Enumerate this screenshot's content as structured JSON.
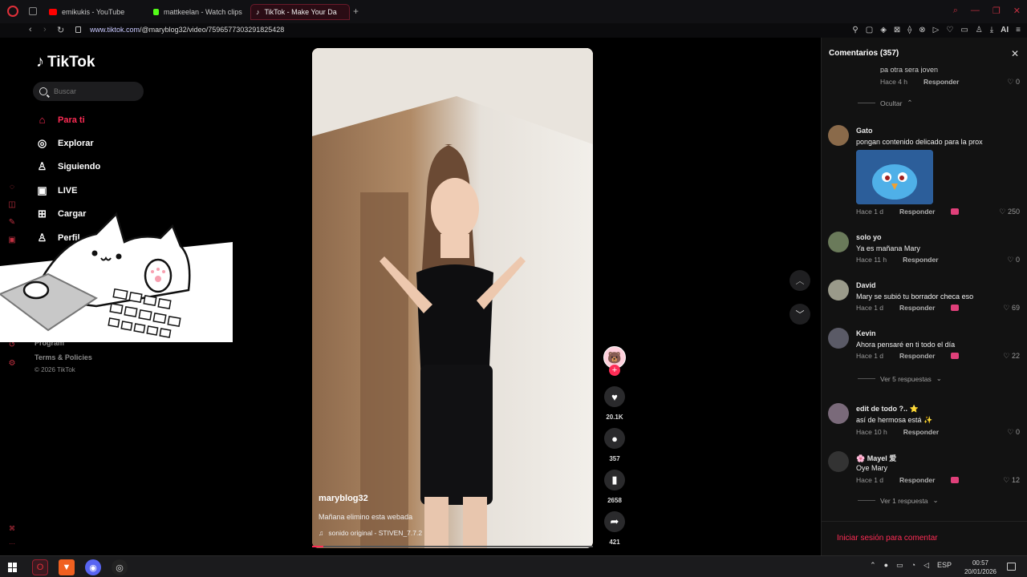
{
  "browser": {
    "tabs": [
      {
        "label": "emikukis - YouTube",
        "favicon_color": "#ff0000"
      },
      {
        "label": "mattkeelan - Watch clips",
        "favicon_color": "#53fc18"
      },
      {
        "label": "TikTok - Make Your Da",
        "favicon_color": "#ffffff"
      }
    ],
    "new_tab": "+",
    "url_domain": "www.tiktok.com",
    "url_path": "/@maryblog32/video/7596577303291825428",
    "ai_label": "AI",
    "window_controls": [
      "⌕",
      "—",
      "❐",
      "✕"
    ]
  },
  "tiktok": {
    "logo": "TikTok",
    "search_placeholder": "Buscar",
    "nav": [
      {
        "label": "Para ti",
        "icon": "home-icon",
        "active": true
      },
      {
        "label": "Explorar",
        "icon": "compass-icon"
      },
      {
        "label": "Siguiendo",
        "icon": "person-icon"
      },
      {
        "label": "LIVE",
        "icon": "live-icon"
      },
      {
        "label": "Cargar",
        "icon": "upload-icon"
      },
      {
        "label": "Perfil",
        "icon": "profile-icon"
      }
    ],
    "more": "...",
    "footer_links": [
      "Program",
      "Terms & Policies"
    ],
    "copyright": "© 2026 TikTok"
  },
  "video": {
    "username": "maryblog32",
    "description": "Mañana elimino esta webada",
    "sound": "sonido original - STIVEN_7.7.2",
    "progress": 0.04,
    "likes": "20.1K",
    "comments": "357",
    "saves": "2658",
    "shares": "421"
  },
  "comments_panel": {
    "title": "Comentarios (357)",
    "top_partial": {
      "text": "pa otra sera joven",
      "time": "Hace 4 h",
      "reply": "Responder",
      "likes": "0"
    },
    "hide_label": "Ocultar",
    "items": [
      {
        "name": "Gato",
        "text": "pongan contenido delicado para la prox",
        "time": "Hace 1 d",
        "reply": "Responder",
        "likes": "250",
        "creator_liked": true,
        "avatar_color": "#8a6a4a",
        "has_image": true
      },
      {
        "name": "solo yo",
        "text": "Ya es mañana Mary",
        "time": "Hace 11 h",
        "reply": "Responder",
        "likes": "0",
        "creator_liked": false,
        "avatar_color": "#6a7a5a"
      },
      {
        "name": "David",
        "text": "Mary se subió tu borrador checa eso",
        "time": "Hace 1 d",
        "reply": "Responder",
        "likes": "69",
        "creator_liked": true,
        "avatar_color": "#9a9a8a"
      },
      {
        "name": "Kevin",
        "text": "Ahora pensaré en ti todo el día",
        "time": "Hace 1 d",
        "reply": "Responder",
        "likes": "22",
        "creator_liked": true,
        "avatar_color": "#5a5a66",
        "more_replies": "Ver 5 respuestas"
      },
      {
        "name": "edit de todo ?.. ⭐",
        "text": "así de hermosa está ✨",
        "time": "Hace 10 h",
        "reply": "Responder",
        "likes": "0",
        "creator_liked": false,
        "avatar_color": "#7a6a7a"
      },
      {
        "name": "🌸 Mayel 爱",
        "text": "Oye Mary",
        "time": "Hace 1 d",
        "reply": "Responder",
        "likes": "12",
        "creator_liked": true,
        "avatar_color": "#333333",
        "more_replies": "Ver 1 respuesta"
      }
    ],
    "login_prompt": "Iniciar sesión para comentar"
  },
  "taskbar": {
    "lang": "ESP",
    "time": "00:57",
    "date": "20/01/2026"
  },
  "colors": {
    "accent": "#fe2c55",
    "opera": "#e0303a",
    "panel": "#121212"
  }
}
